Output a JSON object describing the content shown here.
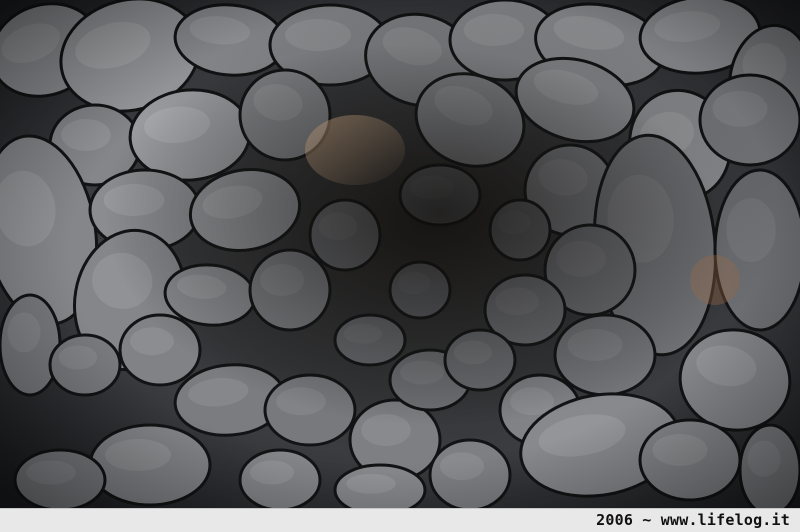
{
  "photo": {
    "subject": "stacked-stone-dome-interior-icon"
  },
  "caption": {
    "year": "2006",
    "separator": "~",
    "site": "www.lifelog.it",
    "text": "2006 ~ www.lifelog.it"
  }
}
